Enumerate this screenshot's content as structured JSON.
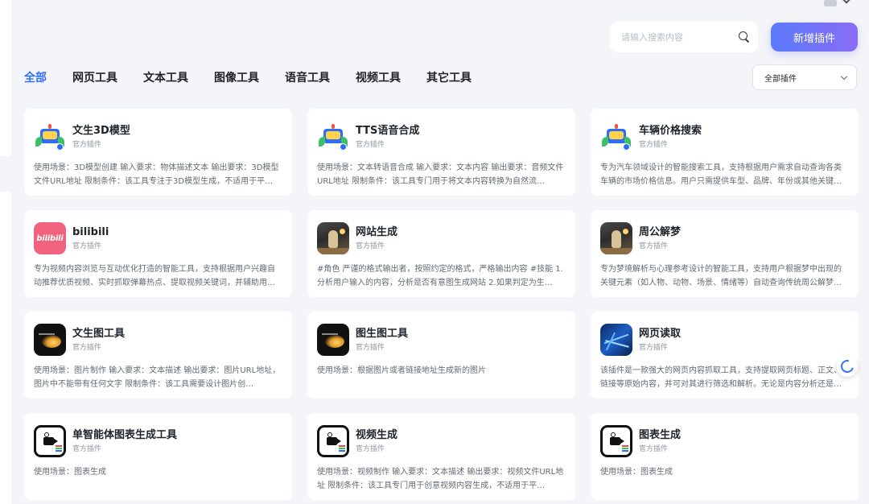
{
  "header": {
    "search_placeholder": "请输入搜索内容",
    "add_button_label": "新增插件"
  },
  "tabs": [
    "全部",
    "网页工具",
    "文本工具",
    "图像工具",
    "语音工具",
    "视频工具",
    "其它工具"
  ],
  "active_tab": "全部",
  "filter": {
    "selected": "全部插件"
  },
  "plugins": [
    {
      "icon": "robot-icon",
      "title": "文生3D模型",
      "subtitle": "官方插件",
      "desc": "使用场景：3D模型创建 输入要求：物体描述文本 输出要求：3D模型文件URL地址 限制条件：该工具专注于3D模型生成，不适用于平…"
    },
    {
      "icon": "robot-icon",
      "title": "TTS语音合成",
      "subtitle": "官方插件",
      "desc": "使用场景：文本转语音合成 输入要求：文本内容 输出要求：音频文件URL地址 限制条件：该工具专门用于将文本内容转换为自然流…"
    },
    {
      "icon": "robot-icon",
      "title": "车辆价格搜索",
      "subtitle": "官方插件",
      "desc": "专为汽车领域设计的智能搜索工具，支持根据用户需求自动查询各类车辆的市场价格信息。用户只需提供车型、品牌、年份或其他关键…"
    },
    {
      "icon": "bilibili-logo-icon",
      "icon_text": "bilibili",
      "title": "bilibili",
      "subtitle": "官方插件",
      "desc": "专为视频内容浏览与互动优化打造的智能工具，支持根据用户兴趣自动推荐优质视频、实时抓取弹幕热点、提取视频关键词，并辅助用…"
    },
    {
      "icon": "portrait-photo-icon",
      "title": "网站生成",
      "subtitle": "官方插件",
      "desc": "#角色 严谨的格式输出者，按照约定的格式，严格输出内容 #技能 1. 分析用户输入的内容，分析是否有意图生成网站 2.如果判定为生…"
    },
    {
      "icon": "portrait-photo-icon",
      "title": "周公解梦",
      "subtitle": "官方插件",
      "desc": "专为梦境解析与心理参考设计的智能工具，支持用户根据梦中出现的关键元素（如人物、动物、场景、情绪等）自动查询传统周公解梦…"
    },
    {
      "icon": "dark-glow-icon",
      "title": "文生图工具",
      "subtitle": "官方插件",
      "desc": "使用场景：图片制作 输入要求：文本描述 输出要求：图片URL地址，图片中不能带有任何文字 限制条件：该工具需要设计图片创…"
    },
    {
      "icon": "dark-glow-icon",
      "title": "图生图工具",
      "subtitle": "官方插件",
      "desc": "使用场景：根据图片或者链接地址生成新的图片"
    },
    {
      "icon": "network-icon",
      "title": "网页读取",
      "subtitle": "官方插件",
      "desc": "该插件是一款强大的网页内容抓取工具，支持提取网页标题、正文、链接等原始内容，并可对其进行筛选和解析。无论是内容分析还是…"
    },
    {
      "icon": "video-camera-icon",
      "title": "单智能体图表生成工具",
      "subtitle": "官方插件",
      "desc": "使用场景：图表生成"
    },
    {
      "icon": "video-camera-icon",
      "title": "视频生成",
      "subtitle": "官方插件",
      "desc": "使用场景：视频制作 输入要求：文本描述 输出要求：视频文件URL地址 限制条件：该工具专门用于创意视频内容生成，不适用于平…"
    },
    {
      "icon": "video-camera-icon",
      "title": "图表生成",
      "subtitle": "官方插件",
      "desc": "使用场景：图表生成"
    }
  ],
  "colors": {
    "accent": "#3370ff",
    "button_gradient_start": "#5b7bfb",
    "button_gradient_end": "#8a6cf6",
    "background": "#f4f5f8"
  }
}
